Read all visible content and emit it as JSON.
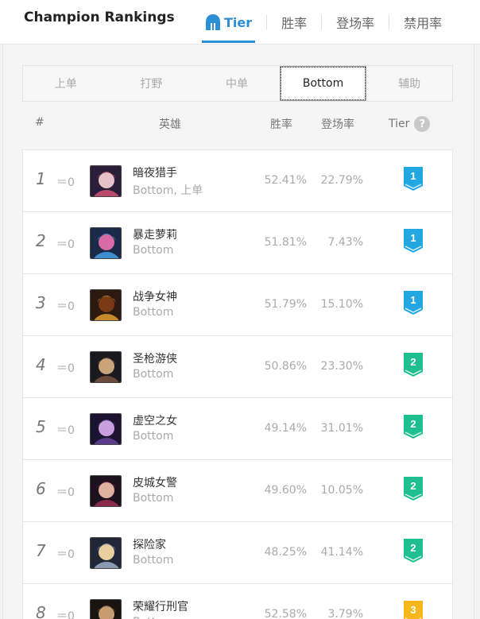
{
  "header": {
    "title": "Champion Rankings",
    "tabs": [
      {
        "label": "Tier",
        "active": true,
        "icon": "helmet-icon"
      },
      {
        "label": "胜率",
        "active": false
      },
      {
        "label": "登场率",
        "active": false
      },
      {
        "label": "禁用率",
        "active": false
      }
    ]
  },
  "positions": [
    {
      "label": "上单",
      "active": false
    },
    {
      "label": "打野",
      "active": false
    },
    {
      "label": "中单",
      "active": false
    },
    {
      "label": "Bottom",
      "active": true
    },
    {
      "label": "辅助",
      "active": false
    }
  ],
  "columns": {
    "rank": "#",
    "champion": "英雄",
    "winrate": "胜率",
    "pickrate": "登场率",
    "tier": "Tier",
    "help": "?"
  },
  "tier_colors": {
    "1": "#22a7e0",
    "2": "#1fbf8f",
    "3": "#f5b71c"
  },
  "rows": [
    {
      "rank": "1",
      "delta": "＝0",
      "name": "暗夜猎手",
      "role": "Bottom, 上单",
      "winrate": "52.41%",
      "pickrate": "22.79%",
      "tier": "1",
      "avatar_colors": [
        "#2a1e3a",
        "#b84a6a",
        "#e7c2c8"
      ]
    },
    {
      "rank": "2",
      "delta": "＝0",
      "name": "暴走萝莉",
      "role": "Bottom",
      "winrate": "51.81%",
      "pickrate": "7.43%",
      "tier": "1",
      "avatar_colors": [
        "#1c2a4a",
        "#3f8fd0",
        "#d86aa8"
      ]
    },
    {
      "rank": "3",
      "delta": "＝0",
      "name": "战争女神",
      "role": "Bottom",
      "winrate": "51.79%",
      "pickrate": "15.10%",
      "tier": "1",
      "avatar_colors": [
        "#2a1a10",
        "#c58a2a",
        "#7a3a16"
      ]
    },
    {
      "rank": "4",
      "delta": "＝0",
      "name": "圣枪游侠",
      "role": "Bottom",
      "winrate": "50.86%",
      "pickrate": "23.30%",
      "tier": "2",
      "avatar_colors": [
        "#1a1a1e",
        "#6a4a3a",
        "#c9a47a"
      ]
    },
    {
      "rank": "5",
      "delta": "＝0",
      "name": "虚空之女",
      "role": "Bottom",
      "winrate": "49.14%",
      "pickrate": "31.01%",
      "tier": "2",
      "avatar_colors": [
        "#1a1430",
        "#5a3a8a",
        "#c8a0e0"
      ]
    },
    {
      "rank": "6",
      "delta": "＝0",
      "name": "皮城女警",
      "role": "Bottom",
      "winrate": "49.60%",
      "pickrate": "10.05%",
      "tier": "2",
      "avatar_colors": [
        "#1e1220",
        "#8a2a4a",
        "#e0b0a0"
      ]
    },
    {
      "rank": "7",
      "delta": "＝0",
      "name": "探险家",
      "role": "Bottom",
      "winrate": "48.25%",
      "pickrate": "41.14%",
      "tier": "2",
      "avatar_colors": [
        "#202838",
        "#8a9ab0",
        "#e8cfa0"
      ]
    },
    {
      "rank": "8",
      "delta": "＝0",
      "name": "荣耀行刑官",
      "role": "Bottom",
      "winrate": "52.58%",
      "pickrate": "3.79%",
      "tier": "3",
      "avatar_colors": [
        "#1a1410",
        "#7a5a3a",
        "#c89a70"
      ]
    }
  ]
}
